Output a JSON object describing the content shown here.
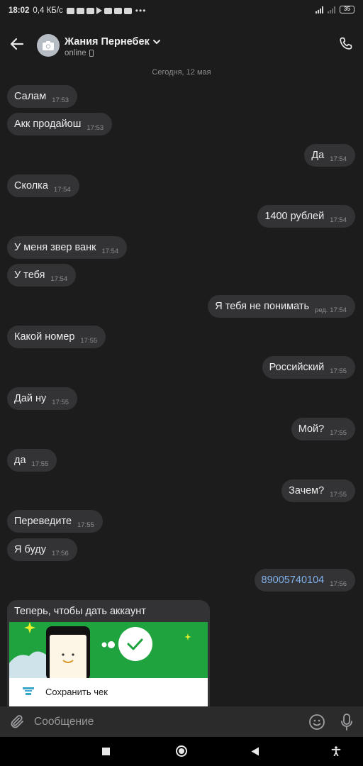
{
  "status_bar": {
    "time": "18:02",
    "network_speed": "0,4 КБ/с",
    "battery": "35"
  },
  "header": {
    "contact_name": "Жания Пернебек",
    "status": "online"
  },
  "chat": {
    "date": "Сегодня, 12 мая",
    "messages": [
      {
        "dir": "in",
        "text": "Салам",
        "time": "17:53"
      },
      {
        "dir": "in",
        "text": "Акк продайош",
        "time": "17:53"
      },
      {
        "dir": "out",
        "text": "Да",
        "time": "17:54"
      },
      {
        "dir": "in",
        "text": "Сколка",
        "time": "17:54"
      },
      {
        "dir": "out",
        "text": "1400 рублей",
        "time": "17:54"
      },
      {
        "dir": "in",
        "text": "У меня звер ванк",
        "time": "17:54"
      },
      {
        "dir": "in",
        "text": "У тебя",
        "time": "17:54"
      },
      {
        "dir": "out",
        "text": "Я тебя не понимать",
        "time": "ред. 17:54"
      },
      {
        "dir": "in",
        "text": "Какой номер",
        "time": "17:55"
      },
      {
        "dir": "out",
        "text": "Российский",
        "time": "17:55"
      },
      {
        "dir": "in",
        "text": "Дай ну",
        "time": "17:55"
      },
      {
        "dir": "out",
        "text": "Мой?",
        "time": "17:55"
      },
      {
        "dir": "in",
        "text": "да",
        "time": "17:55"
      },
      {
        "dir": "out",
        "text": "Зачем?",
        "time": "17:55"
      },
      {
        "dir": "in",
        "text": "Переведите",
        "time": "17:55"
      },
      {
        "dir": "in",
        "text": "Я буду",
        "time": "17:56"
      },
      {
        "dir": "out",
        "text": "89005740104",
        "time": "17:56",
        "link": true
      }
    ],
    "card": {
      "title": "Теперь, чтобы дать аккаунт",
      "save_label": "Сохранить чек"
    }
  },
  "composer": {
    "placeholder": "Сообщение"
  },
  "colors": {
    "background": "#1c1c1d",
    "bubble": "#333335",
    "link": "#7fb0ea",
    "card_green": "#1ea33f"
  },
  "icons": [
    "back-arrow-icon",
    "camera-icon",
    "chevron-down-icon",
    "phone-icon",
    "paperclip-icon",
    "emoji-icon",
    "microphone-icon"
  ]
}
